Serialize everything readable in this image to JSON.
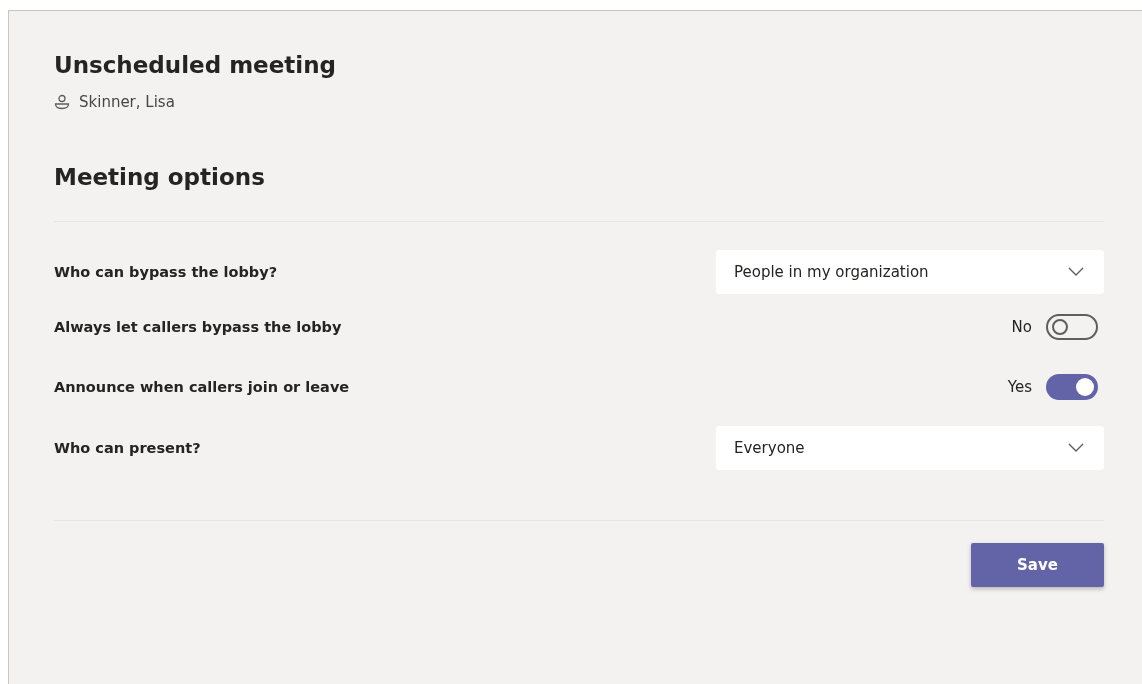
{
  "meeting": {
    "title": "Unscheduled meeting",
    "organizer": "Skinner, Lisa"
  },
  "section_title": "Meeting options",
  "options": [
    {
      "kind": "dropdown",
      "label": "Who can bypass the lobby?",
      "value": "People in my organization"
    },
    {
      "kind": "toggle",
      "label": "Always let callers bypass the lobby",
      "state_text": "No",
      "on": false
    },
    {
      "kind": "toggle",
      "label": "Announce when callers join or leave",
      "state_text": "Yes",
      "on": true
    },
    {
      "kind": "dropdown",
      "label": "Who can present?",
      "value": "Everyone"
    }
  ],
  "buttons": [
    "Save"
  ]
}
